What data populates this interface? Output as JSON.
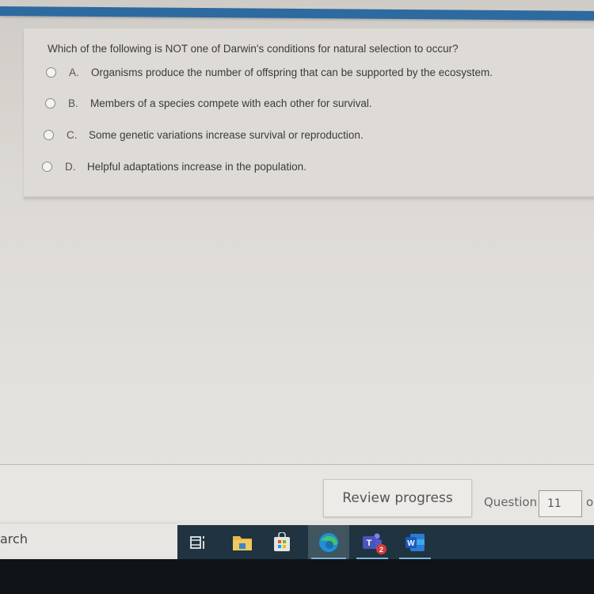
{
  "question": {
    "prompt": "Which of the following is NOT one of Darwin's conditions for natural selection to occur?",
    "options": [
      {
        "letter": "A.",
        "text": "Organisms produce the number of offspring that can be supported by the ecosystem."
      },
      {
        "letter": "B.",
        "text": "Members of a species compete with each other for survival."
      },
      {
        "letter": "C.",
        "text": "Some genetic variations increase survival or reproduction."
      },
      {
        "letter": "D.",
        "text": "Helpful adaptations increase in the population."
      }
    ]
  },
  "footer": {
    "review_label": "Review progress",
    "question_label": "Question",
    "question_number": "11",
    "of_label": "o"
  },
  "taskbar": {
    "search_text": "arch",
    "icons": [
      "task-view",
      "file-explorer",
      "microsoft-store",
      "edge",
      "teams",
      "word"
    ],
    "teams_badge": "2",
    "word_letter": "W",
    "teams_letter": "T"
  },
  "colors": {
    "top_bar": "#2d6aa0",
    "taskbar": "#1f3440",
    "teams_badge": "#d63a3a"
  }
}
